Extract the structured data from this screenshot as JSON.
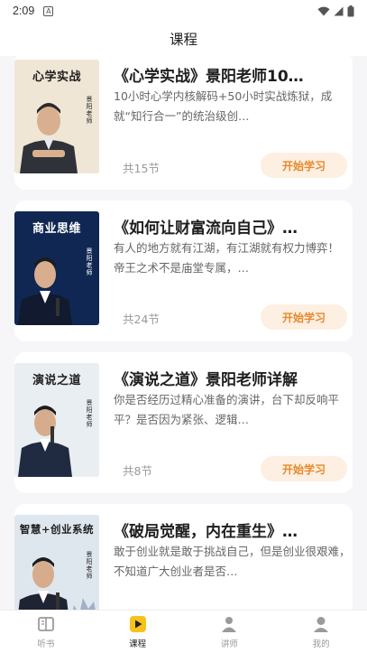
{
  "status_bar": {
    "time": "2:09",
    "badge": "A"
  },
  "header": {
    "title": "课程"
  },
  "courses": [
    {
      "title": "《心学实战》景阳老师10…",
      "description": "10小时心学内核解码+50小时实战炼狱，成就“知行合一”的统治级创…",
      "lessons": "共15节",
      "button": "开始学习",
      "cover_title": "心学实战",
      "cover_sub": "景阳老师",
      "cover_bg": "#efe6d6",
      "cover_text_color": "#1f1f1f"
    },
    {
      "title": "《如何让财富流向自己》…",
      "description": "有人的地方就有江湖，有江湖就有权力博弈！ 帝王之术不是庙堂专属，…",
      "lessons": "共24节",
      "button": "开始学习",
      "cover_title": "商业思维",
      "cover_sub": "景阳老师",
      "cover_bg": "#0f2752",
      "cover_text_color": "#ffffff"
    },
    {
      "title": "《演说之道》景阳老师详解",
      "description": "你是否经历过精心准备的演讲，台下却反响平平？是否因为紧张、逻辑…",
      "lessons": "共8节",
      "button": "开始学习",
      "cover_title": "演说之道",
      "cover_sub": "景阳老师",
      "cover_bg": "#e9eef3",
      "cover_text_color": "#1f1f1f"
    },
    {
      "title": "《破局觉醒，内在重生》…",
      "description": "敢于创业就是敢于挑战自己，但是创业很艰难，不知道广大创业者是否…",
      "lessons": "",
      "button": "",
      "cover_title": "智慧+创业系统",
      "cover_sub": "景阳老师",
      "cover_bg": "#dfe7ee",
      "cover_text_color": "#1f1f1f"
    }
  ],
  "nav": [
    {
      "label": "听书",
      "icon": "book-icon",
      "active": false
    },
    {
      "label": "课程",
      "icon": "play-icon",
      "active": true
    },
    {
      "label": "讲师",
      "icon": "lecturer-icon",
      "active": false
    },
    {
      "label": "我的",
      "icon": "profile-icon",
      "active": false
    }
  ],
  "colors": {
    "accent": "#f7c21b",
    "button_bg": "#fdefe1",
    "button_text": "#e58a2e"
  }
}
